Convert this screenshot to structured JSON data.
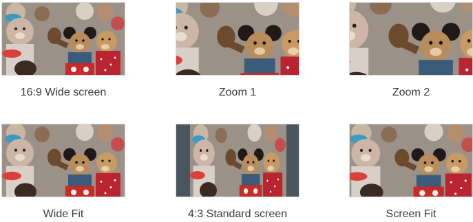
{
  "colors": {
    "background": "#ffffff",
    "label_text": "#3a3a3a",
    "side_bars": "#4a5560"
  },
  "thumbnails": [
    {
      "label": "16:9 Wide screen",
      "mode": "wide",
      "name": "thumb-16-9-wide-screen"
    },
    {
      "label": "Zoom 1",
      "mode": "zoom1",
      "name": "thumb-zoom-1"
    },
    {
      "label": "Zoom 2",
      "mode": "zoom2",
      "name": "thumb-zoom-2"
    },
    {
      "label": "Wide Fit",
      "mode": "widefit",
      "name": "thumb-wide-fit"
    },
    {
      "label": "4:3 Standard screen",
      "mode": "standard",
      "name": "thumb-4-3-standard-screen"
    },
    {
      "label": "Screen Fit",
      "mode": "screenfit",
      "name": "thumb-screen-fit"
    }
  ]
}
